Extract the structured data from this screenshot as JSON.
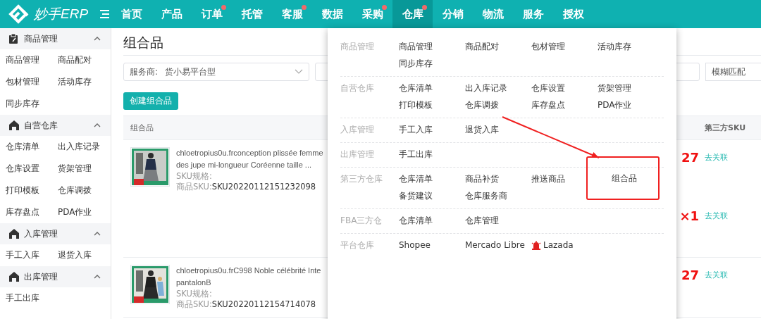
{
  "nav": {
    "logo_text": "妙手ERP",
    "items": [
      {
        "label": "首页",
        "dot": false,
        "selected": false
      },
      {
        "label": "产品",
        "dot": false,
        "selected": false
      },
      {
        "label": "订单",
        "dot": true,
        "selected": false
      },
      {
        "label": "托管",
        "dot": false,
        "selected": false
      },
      {
        "label": "客服",
        "dot": true,
        "selected": false
      },
      {
        "label": "数据",
        "dot": false,
        "selected": false
      },
      {
        "label": "采购",
        "dot": true,
        "selected": false
      },
      {
        "label": "仓库",
        "dot": true,
        "selected": true
      },
      {
        "label": "分销",
        "dot": false,
        "selected": false
      },
      {
        "label": "物流",
        "dot": false,
        "selected": false
      },
      {
        "label": "服务",
        "dot": false,
        "selected": false
      },
      {
        "label": "授权",
        "dot": false,
        "selected": false
      }
    ]
  },
  "sidebar": {
    "sections": [
      {
        "title": "商品管理",
        "kind": "goods",
        "expanded": true,
        "items": [
          "商品管理",
          "商品配对",
          "包材管理",
          "活动库存",
          "同步库存"
        ]
      },
      {
        "title": "自营仓库",
        "kind": "warehouse",
        "expanded": true,
        "items": [
          "仓库清单",
          "出入库记录",
          "仓库设置",
          "货架管理",
          "打印模板",
          "仓库调拨",
          "库存盘点",
          "PDA作业"
        ]
      },
      {
        "title": "入库管理",
        "kind": "warehouse",
        "expanded": true,
        "items": [
          "手工入库",
          "退货入库"
        ]
      },
      {
        "title": "出库管理",
        "kind": "warehouse",
        "expanded": true,
        "items": [
          "手工出库"
        ]
      }
    ]
  },
  "page": {
    "title": "组合品",
    "filter": {
      "label": "服务商:",
      "value": "货小易平台型",
      "match": "模糊匹配"
    },
    "create_button": "创建组合品",
    "table": {
      "columns": [
        "组合品",
        "第三方SKU"
      ],
      "rows": [
        {
          "name_lines": [
            "chloetropius0u.frconception plissée femme",
            "des jupe mi-longueur Coréenne taille ..."
          ],
          "spec_label": "SKU规格:",
          "sku_label": "商品SKU:",
          "sku": "SKU20220112151232098",
          "links": [
            {
              "quantity": "27",
              "action": "去关联"
            },
            {
              "quantity": "×1",
              "action": "去关联"
            }
          ]
        },
        {
          "name_lines": [
            "chloetropius0u.frC998 Noble célébrité Inte",
            "pantalonB"
          ],
          "spec_label": "SKU规格:",
          "sku_label": "商品SKU:",
          "sku": "SKU20220112154714078",
          "links": [
            {
              "quantity": "27",
              "action": "去关联"
            }
          ]
        }
      ]
    }
  },
  "menu": {
    "sections": [
      {
        "label": "商品管理",
        "items": [
          {
            "label": "商品管理",
            "highlighted": false
          },
          {
            "label": "商品配对",
            "highlighted": false
          },
          {
            "label": "包材管理",
            "highlighted": false
          },
          {
            "label": "活动库存",
            "highlighted": false
          },
          {
            "label": "同步库存",
            "highlighted": false
          }
        ]
      },
      {
        "label": "自营仓库",
        "items": [
          {
            "label": "仓库清单",
            "highlighted": false
          },
          {
            "label": "出入库记录",
            "highlighted": false
          },
          {
            "label": "仓库设置",
            "highlighted": false
          },
          {
            "label": "货架管理",
            "highlighted": false
          },
          {
            "label": "打印模板",
            "highlighted": false
          },
          {
            "label": "仓库调拨",
            "highlighted": false
          },
          {
            "label": "库存盘点",
            "highlighted": false
          },
          {
            "label": "PDA作业",
            "highlighted": false
          }
        ]
      },
      {
        "label": "入库管理",
        "items": [
          {
            "label": "手工入库",
            "highlighted": false
          },
          {
            "label": "退货入库",
            "highlighted": false
          }
        ]
      },
      {
        "label": "出库管理",
        "items": [
          {
            "label": "手工出库",
            "highlighted": false
          }
        ]
      },
      {
        "label": "第三方仓库",
        "items": [
          {
            "label": "仓库清单",
            "highlighted": false
          },
          {
            "label": "商品补货",
            "highlighted": false
          },
          {
            "label": "推送商品",
            "highlighted": false
          },
          {
            "label": "组合品",
            "highlighted": true
          },
          {
            "label": "备货建议",
            "highlighted": false
          },
          {
            "label": "仓库服务商",
            "highlighted": false
          }
        ]
      },
      {
        "label": "FBA三方仓",
        "items": [
          {
            "label": "仓库清单",
            "highlighted": false
          },
          {
            "label": "仓库管理",
            "highlighted": false
          }
        ]
      },
      {
        "label": "平台仓库",
        "items": [
          {
            "label": "Shopee",
            "highlighted": false,
            "kind": "plain"
          },
          {
            "label": "Mercado Libre",
            "highlighted": false,
            "kind": "plain"
          },
          {
            "label": "Lazada",
            "highlighted": false,
            "kind": "alert"
          }
        ]
      }
    ]
  }
}
